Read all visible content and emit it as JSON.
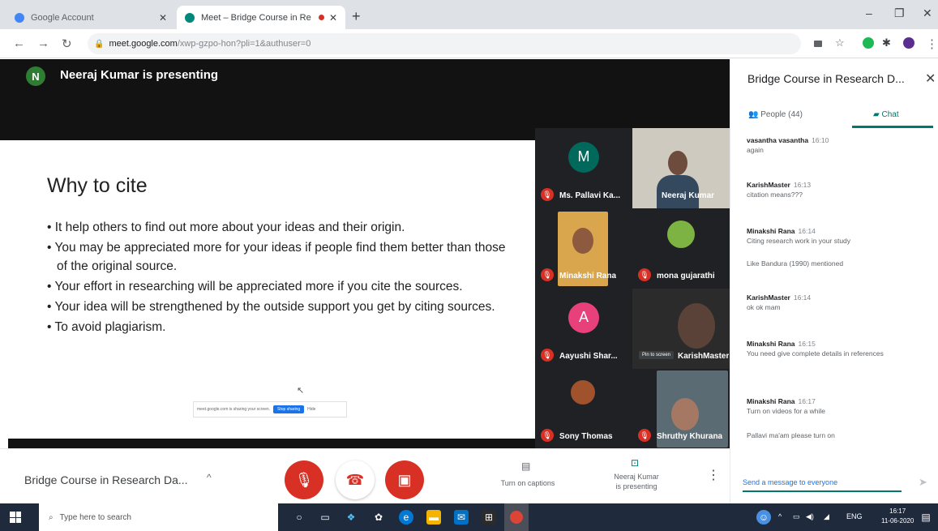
{
  "browser": {
    "tabs": [
      {
        "title": "Google Account"
      },
      {
        "title": "Meet – Bridge Course in Re"
      }
    ],
    "new_tab": "+",
    "window_controls": [
      "–",
      "❐",
      "✕"
    ],
    "url_host": "meet.google.com",
    "url_path": "/xwp-gzpo-hon?pli=1&authuser=0"
  },
  "meet": {
    "presenter_initial": "N",
    "presenter_status": "Neeraj Kumar is presenting",
    "slide": {
      "title": "Why to cite",
      "bullets": [
        "It help others to find out more about your ideas and their origin.",
        "You may be appreciated more for your ideas if people find them better than those of the original source.",
        "Your effort in researching will be appreciated more if you cite the sources.",
        "Your idea will be strengthened by the outside support you get by citing sources.",
        "To avoid plagiarism."
      ],
      "share_bar_text": "meet.google.com is sharing your screen.",
      "share_bar_button": "Stop sharing",
      "share_bar_hide": "Hide"
    },
    "participants": [
      {
        "name": "Ms. Pallavi Ka...",
        "initial": "M",
        "color": "#00695c"
      },
      {
        "name": "Neeraj Kumar"
      },
      {
        "name": "Minakshi Rana"
      },
      {
        "name": "mona gujarathi"
      },
      {
        "name": "Aayushi Shar...",
        "initial": "A",
        "color": "#e8407a"
      },
      {
        "name": "KarishMaster",
        "pin_label": "Pin to screen"
      },
      {
        "name": "Sony Thomas"
      },
      {
        "name": "Shruthy Khurana"
      }
    ],
    "controls": {
      "meeting_name": "Bridge Course in Research Da...",
      "captions_label": "Turn on captions",
      "presenting_label_1": "Neeraj Kumar",
      "presenting_label_2": "is presenting"
    }
  },
  "panel": {
    "title": "Bridge Course in Research D...",
    "people_tab": "People (44)",
    "chat_tab": "Chat",
    "messages": [
      {
        "author": "vasantha vasantha",
        "time": "16:10",
        "text": "again"
      },
      {
        "author": "KarishMaster",
        "time": "16:13",
        "text": "citation means???"
      },
      {
        "author": "Minakshi Rana",
        "time": "16:14",
        "text": "Citing research work in your study"
      },
      {
        "author": "",
        "time": "",
        "text": "Like Bandura (1990) mentioned"
      },
      {
        "author": "KarishMaster",
        "time": "16:14",
        "text": "ok ok mam"
      },
      {
        "author": "Minakshi Rana",
        "time": "16:15",
        "text": "You need give complete details in references"
      },
      {
        "author": "Minakshi Rana",
        "time": "16:17",
        "text": "Turn on videos for a while"
      },
      {
        "author": "",
        "time": "",
        "text": "Pallavi ma'am please turn on"
      }
    ],
    "input_placeholder": "Send a message to everyone"
  },
  "taskbar": {
    "search_placeholder": "Type here to search",
    "lang": "ENG",
    "time": "16:17",
    "date": "11-06-2020"
  },
  "colors": {
    "meet_red": "#d93025",
    "meet_teal": "#00796b",
    "taskbar": "#1f2a3c"
  }
}
